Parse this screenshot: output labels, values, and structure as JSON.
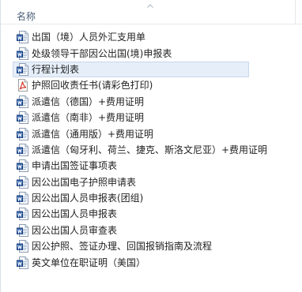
{
  "header": {
    "name_column": "名称"
  },
  "files": [
    {
      "name": "出国（境）人员外汇支用单",
      "type": "word"
    },
    {
      "name": "处级领导干部因公出国(境)申报表",
      "type": "word"
    },
    {
      "name": "行程计划表",
      "type": "word",
      "selected": true
    },
    {
      "name": "护照回收责任书(请彩色打印)",
      "type": "pdf"
    },
    {
      "name": "派遣信（德国）+费用证明",
      "type": "word"
    },
    {
      "name": "派遣信（南非）+费用证明",
      "type": "word"
    },
    {
      "name": "派遣信（通用版）+费用证明",
      "type": "word"
    },
    {
      "name": "派遣信（匈牙利、荷兰、捷克、斯洛文尼亚）+费用证明",
      "type": "word"
    },
    {
      "name": "申请出国签证事项表",
      "type": "word"
    },
    {
      "name": "因公出国电子护照申请表",
      "type": "word"
    },
    {
      "name": "因公出国人员申报表(团组)",
      "type": "word"
    },
    {
      "name": "因公出国人员申报表",
      "type": "word"
    },
    {
      "name": "因公出国人员审查表",
      "type": "word"
    },
    {
      "name": "因公护照、签证办理、回国报销指南及流程",
      "type": "word"
    },
    {
      "name": "英文单位在职证明（美国）",
      "type": "word"
    }
  ]
}
